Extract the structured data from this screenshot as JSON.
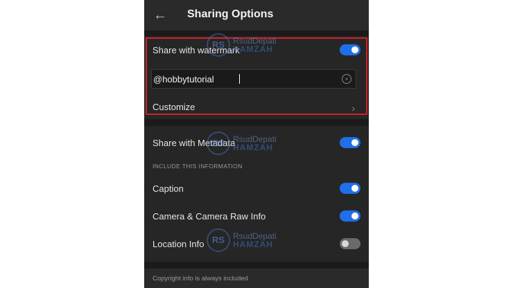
{
  "header": {
    "title": "Sharing Options",
    "back_icon": "arrow-left-icon"
  },
  "watermark_section": {
    "toggle_label": "Share with watermark",
    "toggle_on": true,
    "text_value": "@hobbytutorial",
    "customize_label": "Customize"
  },
  "metadata_section": {
    "toggle_label": "Share with Metadata",
    "toggle_on": true,
    "include_heading": "INCLUDE THIS INFORMATION",
    "items": [
      {
        "label": "Caption",
        "on": true
      },
      {
        "label": "Camera & Camera Raw Info",
        "on": true
      },
      {
        "label": "Location Info",
        "on": false
      }
    ]
  },
  "footer": {
    "note": "Copyright info is always included"
  },
  "watermark_overlay": {
    "line1": "RsudDepati",
    "line2": "HAMZAH"
  },
  "colors": {
    "accent": "#1f6fe8",
    "highlight": "#d0222b"
  }
}
